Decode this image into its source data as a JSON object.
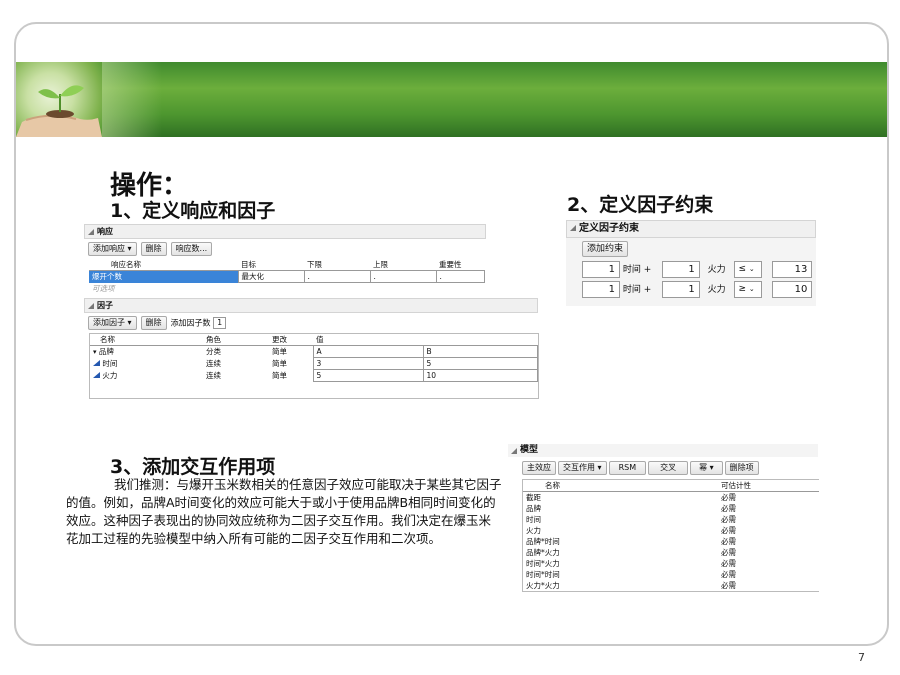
{
  "heading": "操作：",
  "section1": {
    "title": "1、定义响应和因子"
  },
  "section2": {
    "title": "2、定义因子约束"
  },
  "section3": {
    "title": "3、添加交互作用项"
  },
  "paragraph": "我们推测：与爆开玉米数相关的任意因子效应可能取决于某些其它因子的值。例如，品牌A时间变化的效应可能大于或小于使用品牌B相同时间变化的效应。这种因子表现出的协同效应统称为二因子交互作用。我们决定在爆玉米花加工过程的先验模型中纳入所有可能的二因子交互作用和二次项。",
  "page_number": "7",
  "response_panel": {
    "title": "响应",
    "buttons": [
      "添加响应 ▾",
      "删除",
      "响应数..."
    ],
    "columns": [
      "响应名称",
      "目标",
      "下限",
      "上限",
      "重要性"
    ],
    "rows": [
      [
        "爆开个数",
        "最大化",
        ".",
        ".",
        "."
      ]
    ],
    "optional": "可选项"
  },
  "factor_panel": {
    "title": "因子",
    "add_button": "添加因子 ▾",
    "delete_button": "删除",
    "count_label": "添加因子数",
    "count_value": "1",
    "columns": [
      "名称",
      "角色",
      "更改",
      "值",
      ""
    ],
    "rows": [
      {
        "name": "品牌",
        "role": "分类",
        "change": "简单",
        "v1": "A",
        "v2": "B",
        "icon": "categorical-icon"
      },
      {
        "name": "时间",
        "role": "连续",
        "change": "简单",
        "v1": "3",
        "v2": "5",
        "icon": "continuous-icon"
      },
      {
        "name": "火力",
        "role": "连续",
        "change": "简单",
        "v1": "5",
        "v2": "10",
        "icon": "continuous-icon"
      }
    ]
  },
  "constraint_panel": {
    "title": "定义因子约束",
    "add_button": "添加约束",
    "rows": [
      {
        "c1": "1",
        "f1": "时间 +",
        "c2": "1",
        "f2": "火力",
        "op": "≤",
        "value": "13"
      },
      {
        "c1": "1",
        "f1": "时间 +",
        "c2": "1",
        "f2": "火力",
        "op": "≥",
        "value": "10"
      }
    ]
  },
  "model_panel": {
    "title": "模型",
    "buttons": [
      "主效应",
      "交互作用 ▾",
      "RSM",
      "交叉",
      "幂 ▾",
      "删除项"
    ],
    "columns": [
      "名称",
      "可估计性"
    ],
    "rows": [
      [
        "截距",
        "必需"
      ],
      [
        "品牌",
        "必需"
      ],
      [
        "时间",
        "必需"
      ],
      [
        "火力",
        "必需"
      ],
      [
        "品牌*时间",
        "必需"
      ],
      [
        "品牌*火力",
        "必需"
      ],
      [
        "时间*火力",
        "必需"
      ],
      [
        "时间*时间",
        "必需"
      ],
      [
        "火力*火力",
        "必需"
      ]
    ]
  },
  "colors": {
    "banner_green": "#4d962f",
    "selection_blue": "#3a84d8"
  }
}
